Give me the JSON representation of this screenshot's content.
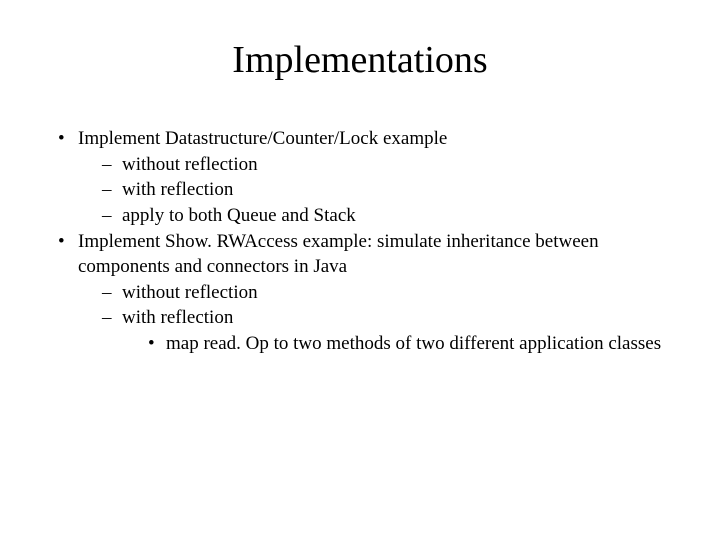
{
  "title": "Implementations",
  "bullets": [
    {
      "text": "Implement Datastructure/Counter/Lock example",
      "dashes": [
        {
          "text": "without reflection"
        },
        {
          "text": "with reflection"
        },
        {
          "text": "apply to both Queue and Stack"
        }
      ]
    },
    {
      "text": "Implement Show. RWAccess example: simulate inheritance between components and connectors in Java",
      "dashes": [
        {
          "text": "without reflection"
        },
        {
          "text": "with reflection",
          "subbullets": [
            {
              "text": "map read. Op to two methods of two different application classes"
            }
          ]
        }
      ]
    }
  ]
}
